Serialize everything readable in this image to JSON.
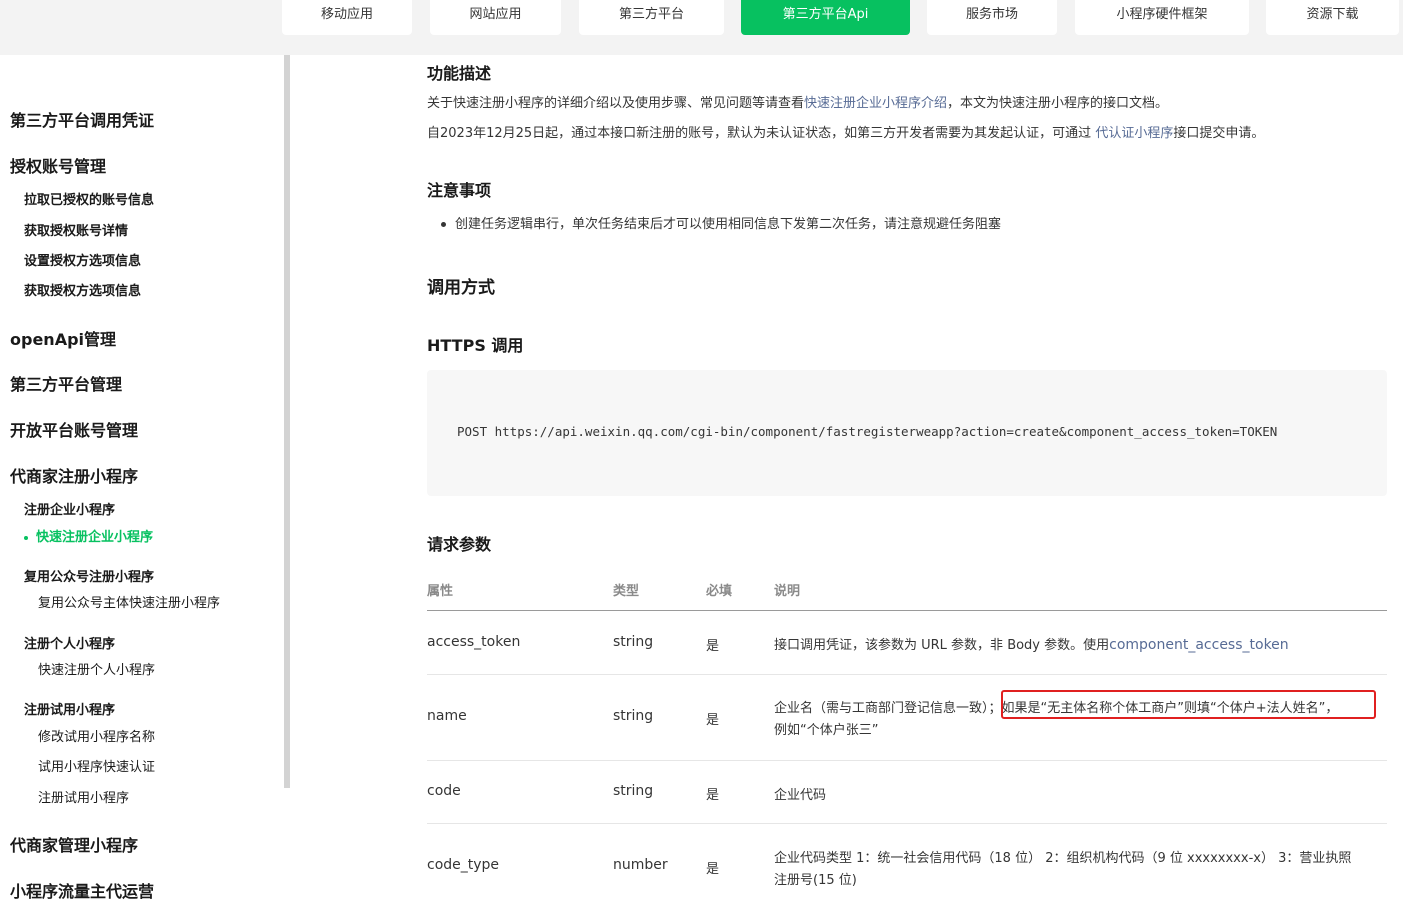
{
  "nav": {
    "tabs": [
      {
        "label": "移动应用"
      },
      {
        "label": "网站应用"
      },
      {
        "label": "第三方平台"
      },
      {
        "label": "第三方平台Api",
        "active": true
      },
      {
        "label": "服务市场"
      },
      {
        "label": "小程序硬件框架"
      },
      {
        "label": "资源下载"
      }
    ],
    "active_color": "#07c160"
  },
  "sidebar": {
    "items": [
      {
        "label": "第三方平台调用凭证",
        "level": 1
      },
      {
        "label": "授权账号管理",
        "level": 1
      },
      {
        "label": "拉取已授权的账号信息",
        "level": 2
      },
      {
        "label": "获取授权账号详情",
        "level": 2
      },
      {
        "label": "设置授权方选项信息",
        "level": 2
      },
      {
        "label": "获取授权方选项信息",
        "level": 2
      },
      {
        "label": "openApi管理",
        "level": 1
      },
      {
        "label": "第三方平台管理",
        "level": 1
      },
      {
        "label": "开放平台账号管理",
        "level": 1
      },
      {
        "label": "代商家注册小程序",
        "level": 1
      },
      {
        "label": "注册企业小程序",
        "level": 2
      },
      {
        "label": "快速注册企业小程序",
        "level": 3,
        "active": true
      },
      {
        "label": "复用公众号注册小程序",
        "level": 2
      },
      {
        "label": "复用公众号主体快速注册小程序",
        "level": 3
      },
      {
        "label": "注册个人小程序",
        "level": 2
      },
      {
        "label": "快速注册个人小程序",
        "level": 3
      },
      {
        "label": "注册试用小程序",
        "level": 2
      },
      {
        "label": "修改试用小程序名称",
        "level": 3
      },
      {
        "label": "试用小程序快速认证",
        "level": 3
      },
      {
        "label": "注册试用小程序",
        "level": 3
      },
      {
        "label": "代商家管理小程序",
        "level": 1
      },
      {
        "label": "小程序流量主代运营",
        "level": 1
      }
    ]
  },
  "content": {
    "desc_title": "功能描述",
    "desc_p1_a": "关于快速注册小程序的详细介绍以及使用步骤、常见问题等请查看",
    "desc_p1_link": "快速注册企业小程序介绍",
    "desc_p1_b": "，本文为快速注册小程序的接口文档。",
    "desc_p2_a": "自2023年12月25日起，通过本接口新注册的账号，默认为未认证状态，如第三方开发者需要为其发起认证，可通过 ",
    "desc_p2_link": "代认证小程序",
    "desc_p2_b": "接口提交申请。",
    "notes_title": "注意事项",
    "notes": [
      "创建任务逻辑串行，单次任务结束后才可以使用相同信息下发第二次任务，请注意规避任务阻塞"
    ],
    "call_title": "调用方式",
    "https_title": "HTTPS 调用",
    "code": "POST https://api.weixin.qq.com/cgi-bin/component/fastregisterweapp?action=create&component_access_token=TOKEN",
    "params_title": "请求参数",
    "table": {
      "headers": [
        "属性",
        "类型",
        "必填",
        "说明"
      ],
      "rows": [
        {
          "name": "access_token",
          "type": "string",
          "required": "是",
          "desc": "接口调用凭证，该参数为 URL 参数，非 Body 参数。使用",
          "desc_link": "component_access_token"
        },
        {
          "name": "name",
          "type": "string",
          "required": "是",
          "desc": "企业名（需与工商部门登记信息一致）；如果是“无主体名称个体工商户”则填“个体户+法人姓名”，",
          "desc2": "例如“个体户张三”"
        },
        {
          "name": "code",
          "type": "string",
          "required": "是",
          "desc": "企业代码"
        },
        {
          "name": "code_type",
          "type": "number",
          "required": "是",
          "desc": "企业代码类型 1：统一社会信用代码（18 位） 2：组织机构代码（9 位 xxxxxxxx-x） 3：营业执照",
          "desc2": "注册号(15 位)"
        }
      ]
    },
    "highlight_color": "#e02020"
  }
}
